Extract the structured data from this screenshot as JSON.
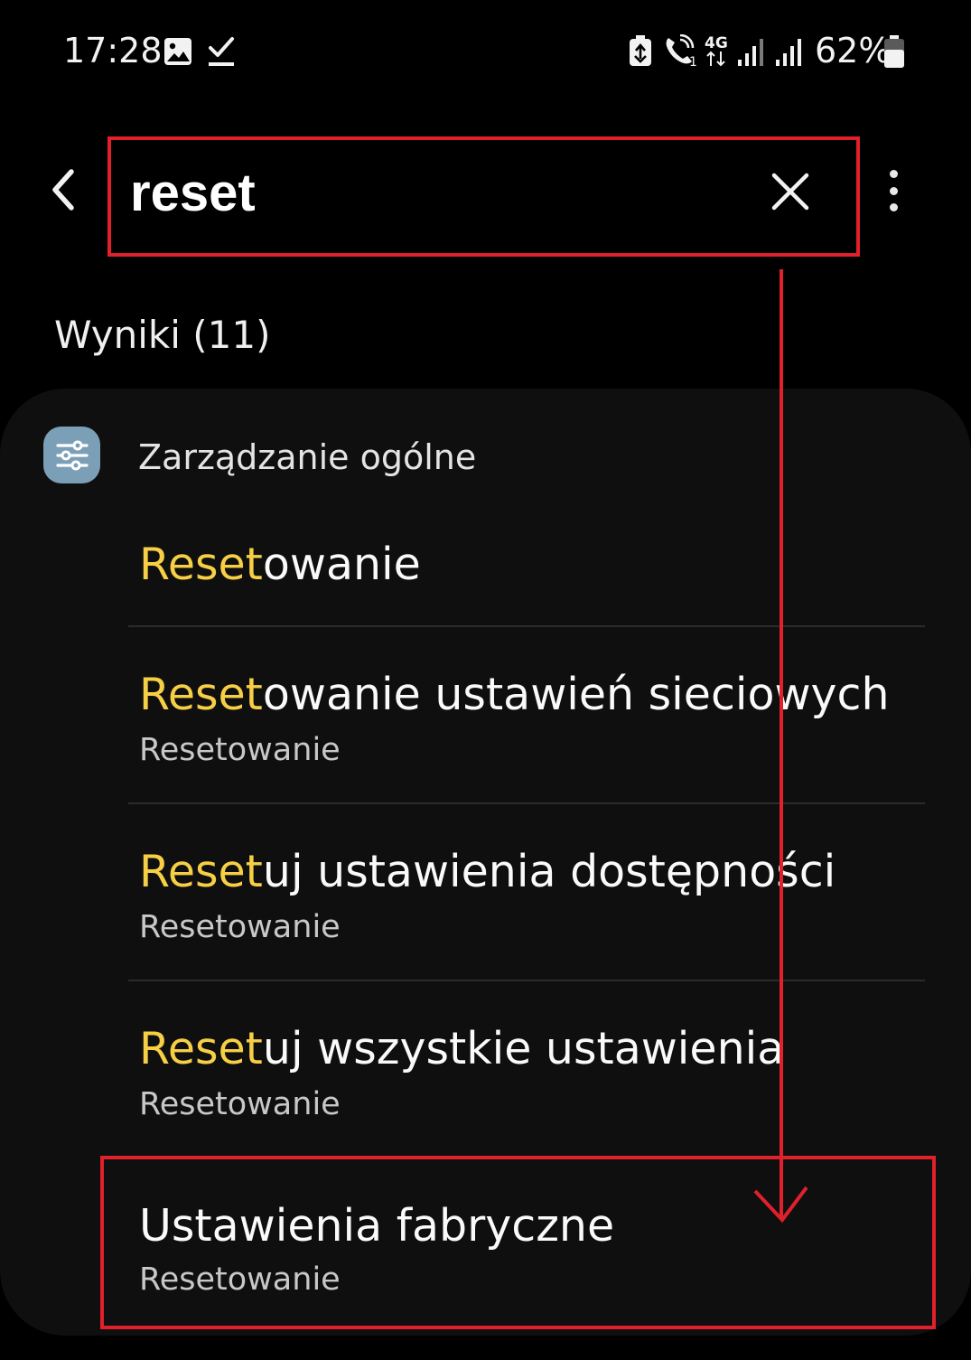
{
  "status_bar": {
    "time": "17:28",
    "battery_percent": "62%",
    "network_type": "4G",
    "icons": [
      "image-icon",
      "download-done-icon",
      "recycle-icon",
      "wifi-call-icon",
      "signal-icon",
      "signal-icon",
      "battery-icon"
    ]
  },
  "search": {
    "query": "reset",
    "back_icon": "chevron-left-icon",
    "clear_icon": "close-icon",
    "more_icon": "more-vertical-icon"
  },
  "results": {
    "count_label": "Wyniki (11)",
    "category": {
      "name": "Zarządzanie ogólne",
      "icon": "sliders-icon"
    },
    "items": [
      {
        "highlight": "Reset",
        "rest": "owanie",
        "subtitle": ""
      },
      {
        "highlight": "Reset",
        "rest": "owanie ustawień sieciowych",
        "subtitle": "Resetowanie"
      },
      {
        "highlight": "Reset",
        "rest": "uj ustawienia dostępności",
        "subtitle": "Resetowanie"
      },
      {
        "highlight": "Reset",
        "rest": "uj wszystkie ustawienia",
        "subtitle": "Resetowanie"
      },
      {
        "highlight": "",
        "rest": "Ustawienia fabryczne",
        "subtitle": "Resetowanie"
      }
    ]
  },
  "colors": {
    "background": "#000000",
    "card": "#0f0f0f",
    "highlight": "#f6cf45",
    "annotation": "#e0202a",
    "category_icon_bg": "#7c9fb8"
  }
}
